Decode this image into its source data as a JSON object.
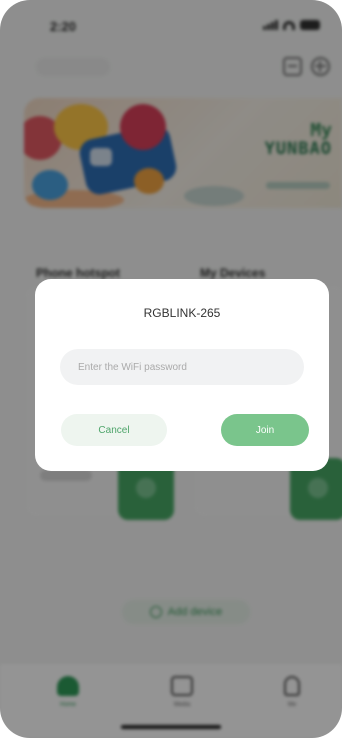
{
  "status_bar": {
    "time": "2:20"
  },
  "banner": {
    "title_line1": "My",
    "title_line2": "YUNBAO"
  },
  "sections": {
    "left_title": "Phone hotspot",
    "right_title": "My Devices"
  },
  "tab_bar": {
    "items": [
      {
        "label": "Home",
        "icon": "home-icon"
      },
      {
        "label": "Media",
        "icon": "media-icon"
      },
      {
        "label": "Me",
        "icon": "person-icon"
      }
    ]
  },
  "add_device": {
    "label": "Add device"
  },
  "dialog": {
    "title": "RGBLINK-265",
    "password_placeholder": "Enter the WiFi password",
    "password_value": "",
    "cancel_label": "Cancel",
    "join_label": "Join"
  },
  "colors": {
    "accent": "#2f9b59",
    "join_button": "#7ac58c",
    "overlay": "rgba(0,0,0,0.42)"
  }
}
